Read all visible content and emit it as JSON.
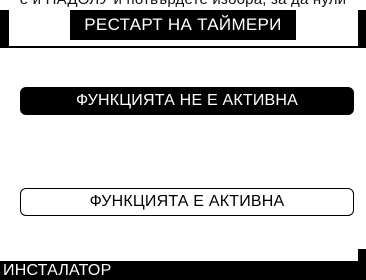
{
  "top_instruction": "е и НАДОЛУ и потвърдете избора, за да нули",
  "header": {
    "title": "РЕСТАРТ НА ТАЙМЕРИ"
  },
  "options": [
    {
      "label": "ФУНКЦИЯТА НЕ Е АКТИВНА",
      "selected": true
    },
    {
      "label": "ФУНКЦИЯТА Е АКТИВНА",
      "selected": false
    }
  ],
  "footer": {
    "label": "ИНСТАЛАТОР"
  },
  "colors": {
    "background": "#ffffff",
    "foreground": "#000000",
    "inverse_text": "#ffffff"
  }
}
